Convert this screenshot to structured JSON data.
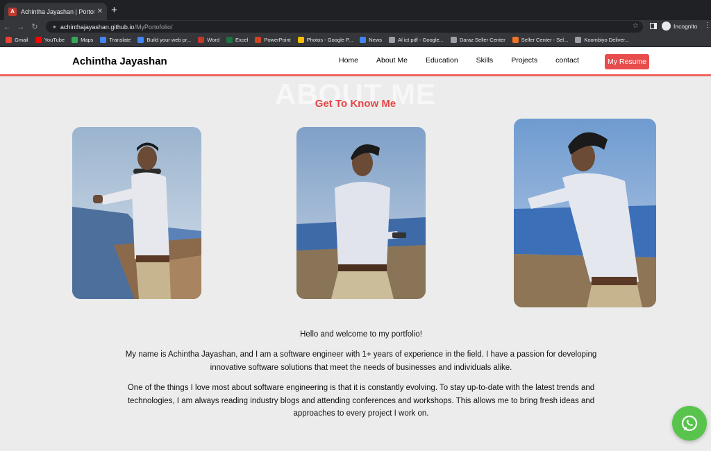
{
  "browser": {
    "tab_title": "Achintha Jayashan | Portofolio",
    "tab_favicon_letter": "A",
    "url_host": "achinthajayashan.github.io",
    "url_path": "/MyPortofolio/",
    "incognito_label": "Incognito",
    "bookmarks": [
      {
        "label": "Gmail",
        "color": "#ea4335"
      },
      {
        "label": "YouTube",
        "color": "#ff0000"
      },
      {
        "label": "Maps",
        "color": "#34a853"
      },
      {
        "label": "Translate",
        "color": "#4285f4"
      },
      {
        "label": "Build your web pr...",
        "color": "#4285f4"
      },
      {
        "label": "Word",
        "color": "#c0392b"
      },
      {
        "label": "Excel",
        "color": "#1e7145"
      },
      {
        "label": "PowerPoint",
        "color": "#d04423"
      },
      {
        "label": "Photos - Google P...",
        "color": "#fbbc05"
      },
      {
        "label": "News",
        "color": "#4285f4"
      },
      {
        "label": "Al ict pdf - Google...",
        "color": "#9aa0a6"
      },
      {
        "label": "Daraz Seller Center",
        "color": "#9aa0a6"
      },
      {
        "label": "Seller Center - Sel...",
        "color": "#f57224"
      },
      {
        "label": "Koombiyo Deliver...",
        "color": "#9aa0a6"
      }
    ]
  },
  "header": {
    "brand": "Achintha Jayashan",
    "nav": [
      "Home",
      "About Me",
      "Education",
      "Skills",
      "Projects",
      "contact"
    ],
    "resume_button": "My Resume"
  },
  "about": {
    "bg_heading": "ABOUT ME",
    "title": "Get To Know Me",
    "hello": "Hello and welcome to my portfolio!",
    "paragraph1": "My name is Achintha Jayashan, and I am a software engineer with 1+ years of experience in the field. I have a passion for developing innovative software solutions that meet the needs of businesses and individuals alike.",
    "paragraph2": "One of the things I love most about software engineering is that it is constantly evolving. To stay up-to-date with the latest trends and technologies, I am always reading industry blogs and attending conferences and workshops. This allows me to bring fresh ideas and approaches to every project I work on."
  },
  "colors": {
    "accent": "#e84545",
    "header_border": "#f0645c",
    "whatsapp": "#58c44e"
  }
}
